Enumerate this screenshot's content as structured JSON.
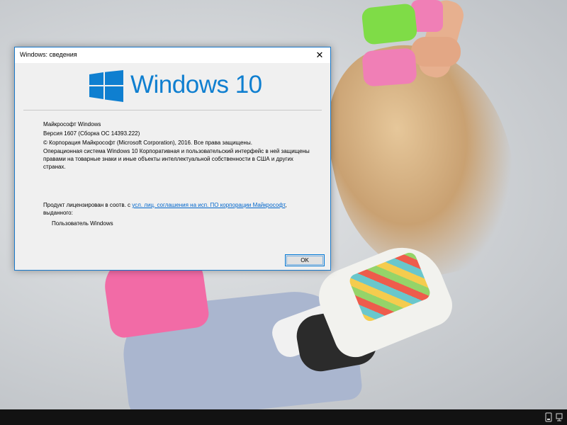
{
  "window": {
    "title": "Windows: сведения",
    "close_glyph": "✕"
  },
  "logo": {
    "text": "Windows 10",
    "color": "#0f7fd0"
  },
  "info": {
    "product": "Майкрософт Windows",
    "version": "Версия 1607 (Сборка ОС 14393.222)",
    "copyright": "© Корпорация Майкрософт (Microsoft Corporation), 2016. Все права защищены.",
    "description": "Операционная система Windows 10 Корпоративная и пользовательский интерфейс в ней защищены правами на товарные знаки и иные объекты интеллектуальной собственности в США и других странах.",
    "license_prefix": "Продукт лицензирован в соотв. с ",
    "license_link": "усл. лиц. соглашения на исп. ПО корпорации Майкрософт",
    "license_suffix": ",",
    "license_line2": "выданного:",
    "licensee": "Пользователь Windows"
  },
  "buttons": {
    "ok": "OK"
  },
  "taskbar": {
    "tray_icons": [
      "touch-keyboard-icon",
      "network-icon"
    ]
  }
}
